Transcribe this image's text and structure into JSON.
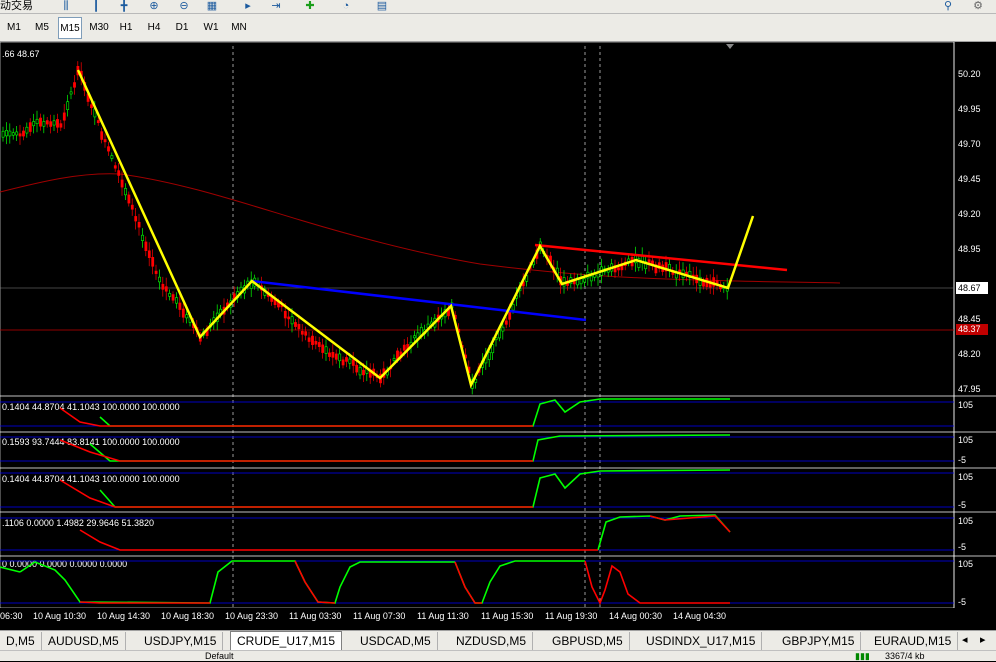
{
  "toolbar": {
    "title_fragment": "动交易"
  },
  "timeframes": [
    "M1",
    "M5",
    "M15",
    "M30",
    "H1",
    "H4",
    "D1",
    "W1",
    "MN"
  ],
  "active_timeframe": "M15",
  "chart": {
    "info": ".66 48.67",
    "price_ticks": [
      "50.20",
      "49.95",
      "49.70",
      "49.45",
      "49.20",
      "48.95",
      "48.67",
      "48.45",
      "48.37",
      "48.20",
      "47.95"
    ],
    "current_price": "48.67",
    "red_line_price": "48.37",
    "indicators": [
      {
        "label": "0.1404 44.8704 41.1043 100.0000 100.0000",
        "top": "105",
        "bottom": ""
      },
      {
        "label": "0.1593 93.7444 83.8141 100.0000 100.0000",
        "top": "105",
        "bottom": "-5"
      },
      {
        "label": "0.1404 44.8704 41.1043 100.0000 100.0000",
        "top": "105",
        "bottom": "-5"
      },
      {
        "label": ".1106 0.0000 1.4982 29.9646 51.3820",
        "top": "105",
        "bottom": "-5"
      },
      {
        "label": "0 0.0000 0.0000 0.0000 0.0000",
        "top": "105",
        "bottom": "-5"
      }
    ],
    "time_labels": [
      "06:30",
      "10 Aug 10:30",
      "10 Aug 14:30",
      "10 Aug 18:30",
      "10 Aug 23:30",
      "11 Aug 03:30",
      "11 Aug 07:30",
      "11 Aug 11:30",
      "11 Aug 15:30",
      "11 Aug 19:30",
      "14 Aug 00:30",
      "14 Aug 04:30"
    ]
  },
  "tabs": [
    "D,M5",
    "AUDUSD,M5",
    "USDJPY,M15",
    "CRUDE_U17,M15",
    "USDCAD,M5",
    "NZDUSD,M5",
    "GBPUSD,M5",
    "USDINDX_U17,M15",
    "GBPJPY,M15",
    "EURAUD,M15"
  ],
  "active_tab": "CRUDE_U17,M15",
  "status": {
    "left": "Default",
    "right": "3367/4 kb"
  },
  "colors": {
    "bull": "#00ff00",
    "bear": "#ff0000",
    "pattern": "#ffff00",
    "trend_blue": "#0000ff",
    "trend_red": "#ff0000",
    "ma": "#a00000"
  }
}
